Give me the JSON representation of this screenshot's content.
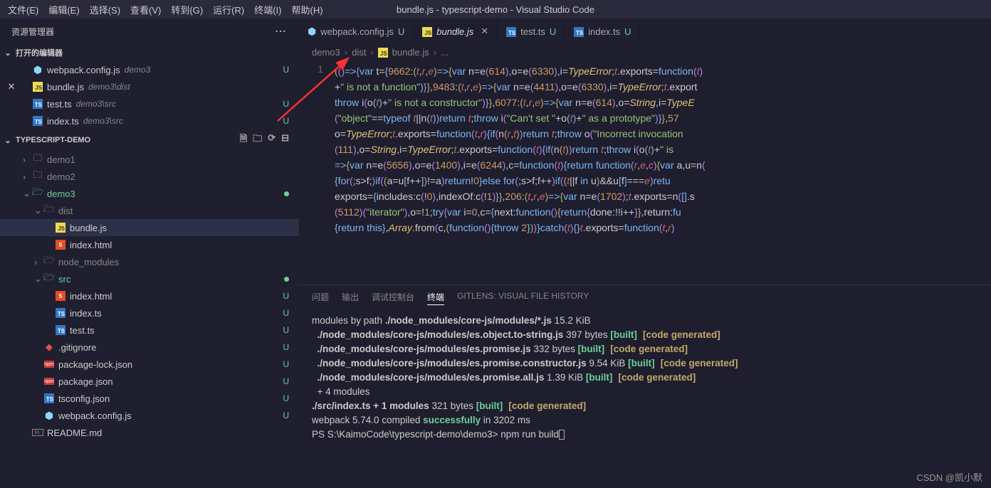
{
  "title": "bundle.js - typescript-demo - Visual Studio Code",
  "menu": [
    "文件(E)",
    "编辑(E)",
    "选择(S)",
    "查看(V)",
    "转到(G)",
    "运行(R)",
    "终端(I)",
    "帮助(H)"
  ],
  "explorer_title": "资源管理器",
  "open_editors_title": "打开的编辑器",
  "open_editors": [
    {
      "icon": "webpack",
      "name": "webpack.config.js",
      "dim": "demo3",
      "badge": "U"
    },
    {
      "icon": "js",
      "name": "bundle.js",
      "dim": "demo3\\dist",
      "badge": "",
      "close": true
    },
    {
      "icon": "ts",
      "name": "test.ts",
      "dim": "demo3\\src",
      "badge": "U"
    },
    {
      "icon": "ts",
      "name": "index.ts",
      "dim": "demo3\\src",
      "badge": "U"
    }
  ],
  "project_title": "TYPESCRIPT-DEMO",
  "tree": [
    {
      "d": 1,
      "chev": ">",
      "icon": "folder",
      "name": "demo1"
    },
    {
      "d": 1,
      "chev": ">",
      "icon": "folder",
      "name": "demo2"
    },
    {
      "d": 1,
      "chev": "v",
      "icon": "folder-open",
      "name": "demo3",
      "dot": true
    },
    {
      "d": 2,
      "chev": "v",
      "icon": "folder-dist",
      "name": "dist"
    },
    {
      "d": 3,
      "icon": "js",
      "name": "bundle.js",
      "selected": true
    },
    {
      "d": 3,
      "icon": "html",
      "name": "index.html"
    },
    {
      "d": 2,
      "chev": ">",
      "icon": "folder-node",
      "name": "node_modules"
    },
    {
      "d": 2,
      "chev": "v",
      "icon": "folder-src",
      "name": "src",
      "dot": true
    },
    {
      "d": 3,
      "icon": "html",
      "name": "index.html",
      "badge": "U"
    },
    {
      "d": 3,
      "icon": "ts",
      "name": "index.ts",
      "badge": "U"
    },
    {
      "d": 3,
      "icon": "ts",
      "name": "test.ts",
      "badge": "U"
    },
    {
      "d": 2,
      "icon": "git",
      "name": ".gitignore",
      "badge": "U"
    },
    {
      "d": 2,
      "icon": "npm",
      "name": "package-lock.json",
      "badge": "U"
    },
    {
      "d": 2,
      "icon": "npm",
      "name": "package.json",
      "badge": "U"
    },
    {
      "d": 2,
      "icon": "ts",
      "name": "tsconfig.json",
      "badge": "U"
    },
    {
      "d": 2,
      "icon": "webpack",
      "name": "webpack.config.js",
      "badge": "U"
    },
    {
      "d": 1,
      "icon": "md",
      "name": "README.md"
    }
  ],
  "tabs": [
    {
      "icon": "webpack",
      "label": "webpack.config.js",
      "badge": "U",
      "italic": false
    },
    {
      "icon": "js",
      "label": "bundle.js",
      "close": true,
      "active": true,
      "italic": true
    },
    {
      "icon": "ts",
      "label": "test.ts",
      "badge": "U",
      "italic": false
    },
    {
      "icon": "ts",
      "label": "index.ts",
      "badge": "U",
      "italic": false
    }
  ],
  "breadcrumb": [
    "demo3",
    "dist",
    "bundle.js",
    "..."
  ],
  "line_no": "1",
  "panel_tabs": [
    "问题",
    "输出",
    "调试控制台",
    "终端",
    "GITLENS: VISUAL FILE HISTORY"
  ],
  "panel_active": 3,
  "terminal": {
    "l1a": "modules by path ",
    "l1b": "./node_modules/core-js/modules/*.js",
    "l1c": " 15.2 KiB",
    "l2a": "  ./node_modules/core-js/modules/es.object.to-string.js",
    "l2b": " 397 bytes ",
    "built": "[built]",
    "cg": "[code generated]",
    "l3a": "  ./node_modules/core-js/modules/es.promise.js",
    "l3b": " 332 bytes ",
    "l4a": "  ./node_modules/core-js/modules/es.promise.constructor.js",
    "l4b": " 9.54 KiB ",
    "l5a": "  ./node_modules/core-js/modules/es.promise.all.js",
    "l5b": " 1.39 KiB ",
    "l6": "  + 4 modules",
    "l7a": "./src/index.ts + 1 modules",
    "l7b": " 321 bytes ",
    "l8a": "webpack 5.74.0 compiled ",
    "l8b": "successfully",
    "l8c": " in 3202 ms",
    "prompt": "PS S:\\KaimoCode\\typescript-demo\\demo3> ",
    "cmd": "npm run build"
  },
  "watermark": "CSDN @凯小默"
}
